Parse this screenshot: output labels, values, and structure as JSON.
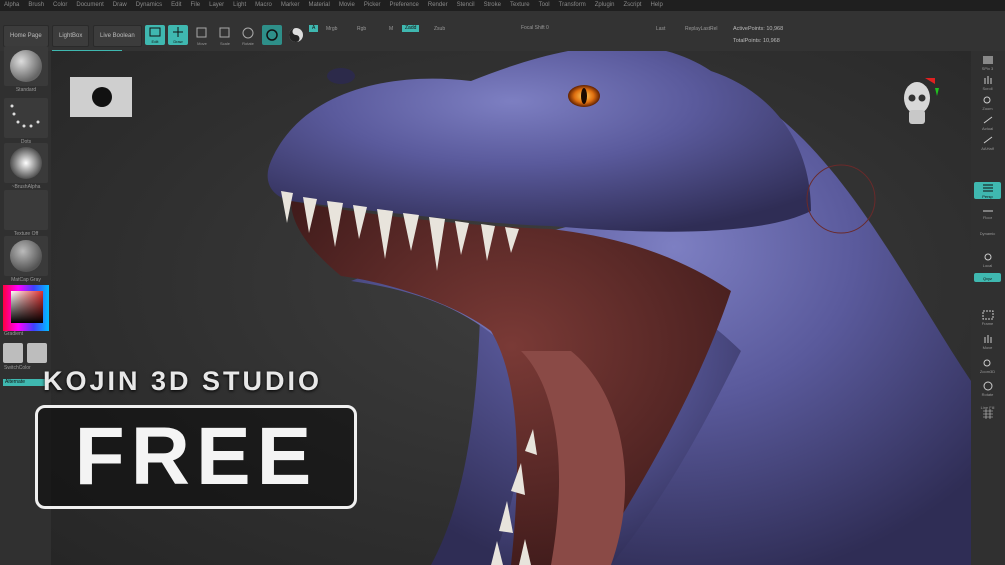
{
  "menu": [
    "Alpha",
    "Brush",
    "Color",
    "Document",
    "Draw",
    "Dynamics",
    "Edit",
    "File",
    "Layer",
    "Light",
    "Macro",
    "Marker",
    "Material",
    "Movie",
    "Picker",
    "Preference",
    "Render",
    "Stencil",
    "Stroke",
    "Texture",
    "Tool",
    "Transform",
    "Zplugin",
    "Zscript",
    "Help"
  ],
  "toolbar": {
    "home": "Home Page",
    "lightbox": "LightBox",
    "live_boolean": "Live Boolean",
    "edit": "Edit",
    "draw": "Draw",
    "move": "Move",
    "scale": "Scale",
    "rotate": "Rotate",
    "a_tag": "A",
    "mrgb": "Mrgb",
    "rgb": "Rgb",
    "m": "M",
    "zadd": "Zadd",
    "zsub": "Zsub",
    "focal_shift": "Focal Shift 0",
    "last": "Last",
    "replay": "ReplayLastRel",
    "active_points": "ActivePoints: 10,968",
    "total_points": "TotalPoints: 10,968"
  },
  "left_shelf": {
    "standard": "Standard",
    "dots": "Dots",
    "brush_alpha": "~BrushAlpha",
    "texture_off": "Texture Off",
    "matcap": "MatCap Gray",
    "gradient": "Gradient",
    "switch_color": "SwitchColor",
    "alternate": "Alternate"
  },
  "right_shelf": {
    "spix": "SPix 3",
    "scroll": "Scroll",
    "zoom": "Zoom",
    "actual": "Actual",
    "aahalf": "AAHalf",
    "persp": "Persp",
    "floor": "Floor",
    "local": "Local",
    "frame": "Frame",
    "move": "Move",
    "zoom3d": "Zoom3D",
    "rotate": "Rotate",
    "line_fill": "Line Fill",
    "dynamic": "Dynamic",
    "qxyz": "Qxyz"
  },
  "overlay": {
    "studio": "KOJIN 3D STUDIO",
    "free": "FREE"
  },
  "colors": {
    "accent": "#3fb8b0"
  }
}
